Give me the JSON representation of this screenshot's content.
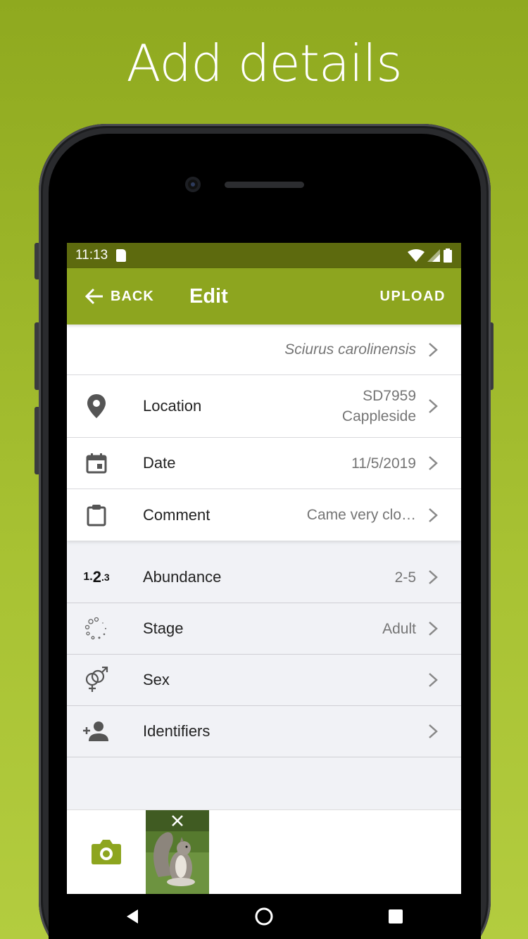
{
  "headline": "Add details",
  "status_bar": {
    "time": "11:13"
  },
  "toolbar": {
    "back_label": "BACK",
    "title": "Edit",
    "upload_label": "UPLOAD"
  },
  "species": {
    "name": "Sciurus carolinensis"
  },
  "details": {
    "location": {
      "label": "Location",
      "value_line1": "SD7959",
      "value_line2": "Cappleside"
    },
    "date": {
      "label": "Date",
      "value": "11/5/2019"
    },
    "comment": {
      "label": "Comment",
      "value": "Came very clo…"
    }
  },
  "attributes": {
    "abundance": {
      "label": "Abundance",
      "value": "2-5",
      "icon_text": "1.2.3"
    },
    "stage": {
      "label": "Stage",
      "value": "Adult"
    },
    "sex": {
      "label": "Sex",
      "value": ""
    },
    "identifiers": {
      "label": "Identifiers",
      "value": ""
    }
  },
  "colors": {
    "accent": "#8da51f",
    "status_bar": "#5d6a0e",
    "background": "#9bb528"
  },
  "icons": {
    "back": "arrow-left-icon",
    "location": "map-pin-icon",
    "date": "calendar-icon",
    "comment": "clipboard-icon",
    "stage": "dots-circle-icon",
    "sex": "gender-icon",
    "identifiers": "person-add-icon",
    "camera": "camera-icon",
    "close": "close-icon"
  }
}
